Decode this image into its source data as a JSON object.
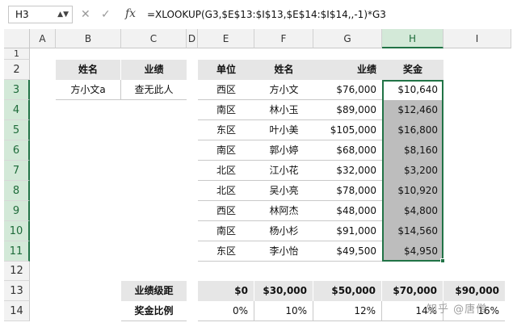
{
  "formula_bar": {
    "name_box": "H3",
    "cancel_icon": "✕",
    "enter_icon": "✓",
    "fx_label": "fx",
    "formula": "=XLOOKUP(G3,$E$13:$I$13,$E$14:$I$14,,-1)*G3"
  },
  "columns": [
    "A",
    "B",
    "C",
    "D",
    "E",
    "F",
    "G",
    "H",
    "I"
  ],
  "rows": [
    "1",
    "2",
    "3",
    "4",
    "5",
    "6",
    "7",
    "8",
    "9",
    "10",
    "11",
    "12",
    "13",
    "14"
  ],
  "lookup_table": {
    "headers": [
      "姓名",
      "业绩"
    ],
    "values": [
      "方小文a",
      "查无此人"
    ]
  },
  "main_table": {
    "headers": [
      "单位",
      "姓名",
      "业绩",
      "奖金"
    ],
    "rows": [
      [
        "西区",
        "方小文",
        "$76,000",
        "$10,640"
      ],
      [
        "南区",
        "林小玉",
        "$89,000",
        "$12,460"
      ],
      [
        "东区",
        "叶小美",
        "$105,000",
        "$16,800"
      ],
      [
        "南区",
        "郭小婷",
        "$68,000",
        "$8,160"
      ],
      [
        "北区",
        "江小花",
        "$32,000",
        "$3,200"
      ],
      [
        "北区",
        "吴小亮",
        "$78,000",
        "$10,920"
      ],
      [
        "西区",
        "林阿杰",
        "$48,000",
        "$4,800"
      ],
      [
        "南区",
        "杨小杉",
        "$91,000",
        "$14,560"
      ],
      [
        "东区",
        "李小怡",
        "$49,500",
        "$4,950"
      ]
    ]
  },
  "tier_table": {
    "label_row13": "业绩级距",
    "label_row14": "奖金比例",
    "thresholds": [
      "$0",
      "$30,000",
      "$50,000",
      "$70,000",
      "$90,000"
    ],
    "rates": [
      "0%",
      "10%",
      "12%",
      "14%",
      "16%"
    ]
  },
  "watermark": "知乎 @唐僧",
  "colors": {
    "accent": "#217346",
    "header_fill": "#e6e6e6",
    "selection_fill": "#bdbdbd"
  }
}
